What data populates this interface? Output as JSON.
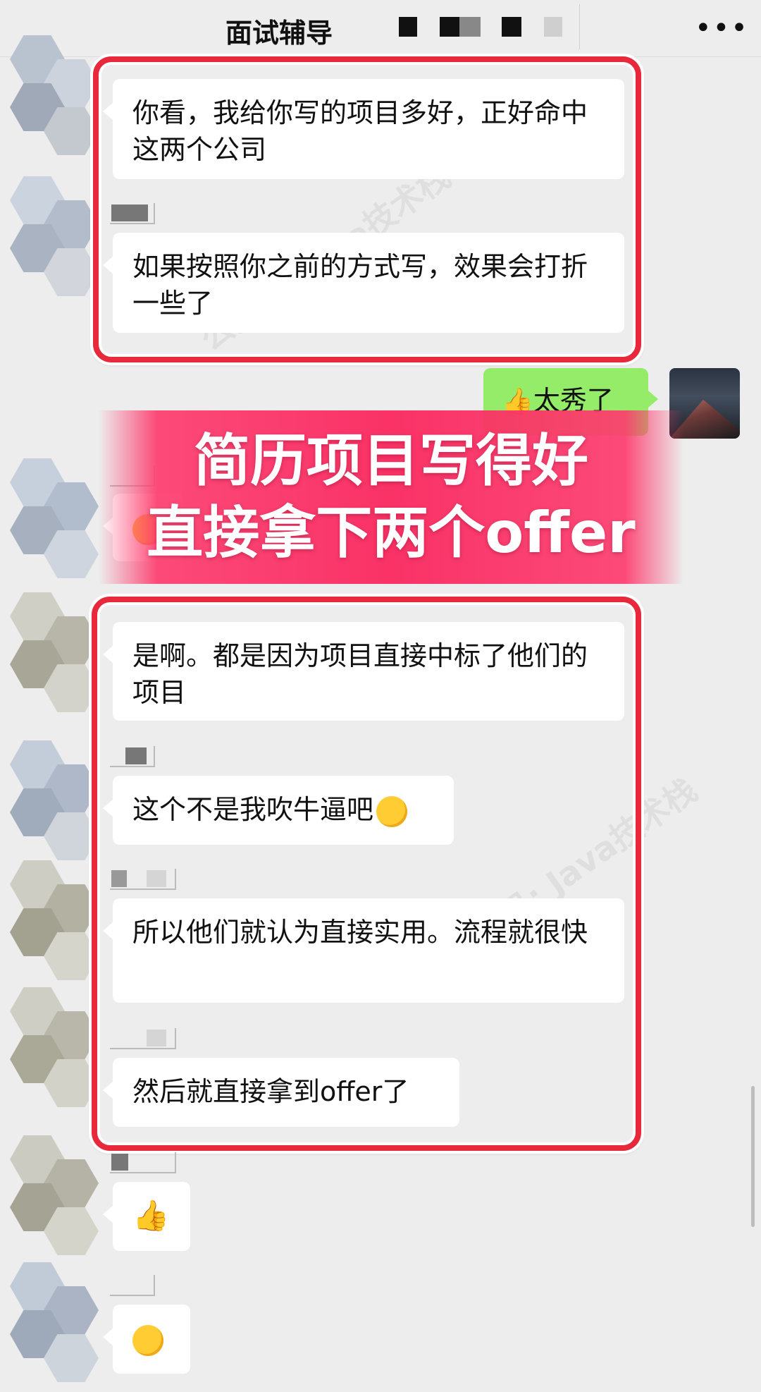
{
  "header": {
    "title": "面试辅导",
    "more_icon": "more-horizontal-icon"
  },
  "watermark": "公众号: Java技术栈",
  "messages": [
    {
      "side": "left",
      "text": "你看，我给你写的项目多好，正好命中这两个公司"
    },
    {
      "side": "left",
      "text": "如果按照你之前的方式写，效果会打折一些了"
    },
    {
      "side": "right",
      "text": "太秀了",
      "icon": "thumbs-up-emoji"
    },
    {
      "side": "left",
      "text": "是啊。都是因为项目直接中标了他们的项目"
    },
    {
      "side": "left",
      "text": "这个不是我吹牛逼吧",
      "icon": "smirk-emoji"
    },
    {
      "side": "left",
      "text": "所以他们就认为直接实用。流程就很快"
    },
    {
      "side": "left",
      "text": "然后就直接拿到offer了"
    },
    {
      "side": "left",
      "icon": "thumbs-up-emoji"
    },
    {
      "side": "left",
      "icon": "grinning-emoji"
    }
  ],
  "banner": {
    "line1": "简历项目写得好",
    "line2": "直接拿下两个offer"
  },
  "colors": {
    "highlight": "#e8283b",
    "banner": "#fa285f",
    "self_bubble": "#95ec69",
    "background": "#ededed"
  }
}
